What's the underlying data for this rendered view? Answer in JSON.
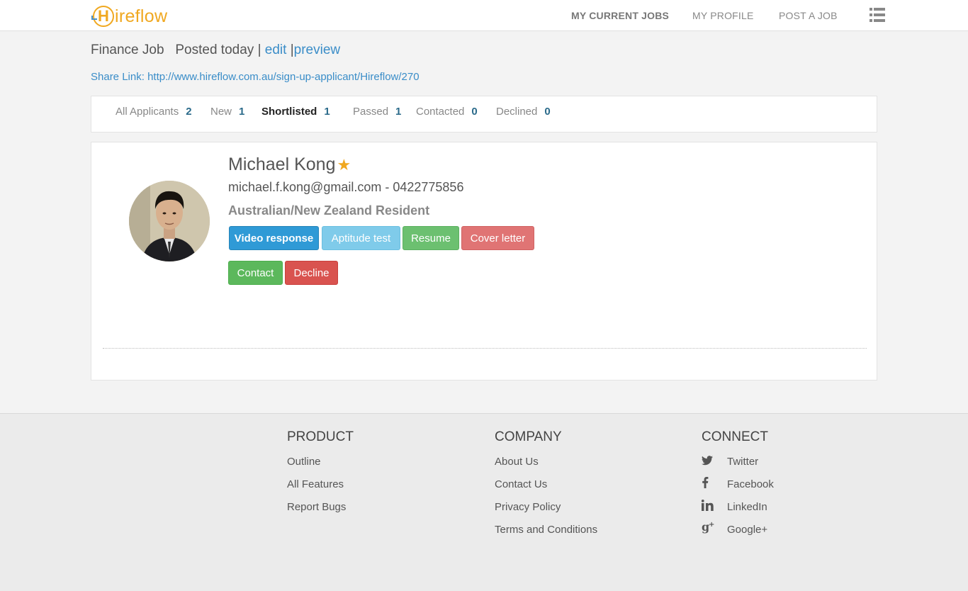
{
  "header": {
    "logo_text": "ireflow",
    "logo_initial": "H",
    "nav": [
      {
        "label": "MY CURRENT JOBS",
        "active": true
      },
      {
        "label": "MY PROFILE",
        "active": false
      },
      {
        "label": "POST A JOB",
        "active": false
      }
    ],
    "menu_icon": "list-icon"
  },
  "job": {
    "title": "Finance Job",
    "posted": "Posted today",
    "separator": "|",
    "edit_label": "edit",
    "preview_label": "preview",
    "share_label": "Share Link:",
    "share_url": "http://www.hireflow.com.au/sign-up-applicant/Hireflow/270"
  },
  "filters": [
    {
      "label": "All Applicants",
      "count": "2",
      "active": false
    },
    {
      "label": "New",
      "count": "1",
      "active": false
    },
    {
      "label": "Shortlisted",
      "count": "1",
      "active": true
    },
    {
      "label": "Passed",
      "count": "1",
      "active": false
    },
    {
      "label": "Contacted",
      "count": "0",
      "active": false
    },
    {
      "label": "Declined",
      "count": "0",
      "active": false
    }
  ],
  "applicant": {
    "name": "Michael Kong",
    "star": "★",
    "email_phone": "michael.f.kong@gmail.com - 0422775856",
    "residency": "Australian/New Zealand Resident",
    "buttons": {
      "video": "Video response",
      "aptitude": "Aptitude test",
      "resume": "Resume",
      "cover": "Cover letter",
      "contact": "Contact",
      "decline": "Decline"
    }
  },
  "footer": {
    "product": {
      "title": "PRODUCT",
      "links": [
        "Outline",
        "All Features",
        "Report Bugs"
      ]
    },
    "company": {
      "title": "COMPANY",
      "links": [
        "About Us",
        "Contact Us",
        "Privacy Policy",
        "Terms and Conditions"
      ]
    },
    "connect": {
      "title": "CONNECT",
      "links": [
        {
          "label": "Twitter",
          "icon": "twitter-icon"
        },
        {
          "label": "Facebook",
          "icon": "facebook-icon"
        },
        {
          "label": "LinkedIn",
          "icon": "linkedin-icon"
        },
        {
          "label": "Google+",
          "icon": "google-plus-icon"
        }
      ]
    }
  },
  "colors": {
    "brand_orange": "#f0a820",
    "link_blue": "#3a8dc8",
    "count_teal": "#2a6a8a"
  }
}
